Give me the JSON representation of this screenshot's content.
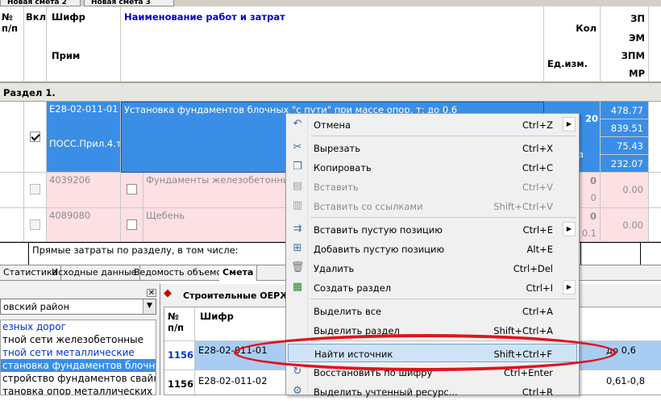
{
  "top_tabs": [
    "Новая смета 2",
    "Новая смета 3"
  ],
  "grid": {
    "headers": {
      "num": "№\nп/п",
      "vkl": "Вкл",
      "shifr": "Шифр",
      "prim": "Прим",
      "name": "Наименование работ и затрат",
      "kol": "Кол",
      "ed": "Ед.изм.",
      "zp": "ЗП",
      "em": "ЭМ",
      "zpm": "ЗПМ",
      "mr": "МР"
    },
    "section_label": "Раздел 1.",
    "main_row": {
      "code": "Е28-02-011-01",
      "name": "Установка фундаментов блочных \"с пути\" при массе опор, т: до 0,6",
      "prim": "ПОСС.Прил.4.т",
      "qty": "20",
      "unit_fragment": "а",
      "zp": "478.77",
      "em": "839.51",
      "zpm": "75.43",
      "mr": "232.07",
      "checked": true
    },
    "sub_rows": [
      {
        "code": "4039206",
        "name": "Фундаменты железобетонные",
        "qty": "0",
        "qty2": "0",
        "val": "0.00"
      },
      {
        "code": "4089080",
        "name": "Щебень",
        "qty": "0",
        "qty2": "0.1",
        "val": "0.00"
      }
    ],
    "footer_text": "Прямые затраты по разделу, в том числе:"
  },
  "bottom_tabs": [
    "Статистика",
    "Исходные данные",
    "Ведомость объемов",
    "Смета"
  ],
  "left_panel": {
    "combo_value": "овский район",
    "tree_items": [
      "езных дорог",
      "тной сети железобетонные",
      "тной сети металлические",
      "становка фундаментов блочнь",
      "стройство фундаментов свайн",
      "тановка опор металлических"
    ],
    "selected_index": 3
  },
  "right_panel": {
    "title": "Строительные ОЕРЖ (",
    "col_num": "№\nп/п",
    "col_shifr": "Шифр",
    "rows": [
      {
        "num": "1156",
        "code": "Е28-02-011-01",
        "desc": "до 0,6"
      },
      {
        "num": "1156",
        "code": "Е28-02-011-02",
        "desc": "0,61-0,8"
      }
    ]
  },
  "context_menu": {
    "items": [
      {
        "label": "Отмена",
        "shortcut": "Ctrl+Z",
        "icon": "undo-icon",
        "submenu": true,
        "disabled": false
      },
      {
        "label": "Вырезать",
        "shortcut": "Ctrl+X",
        "icon": "cut-icon",
        "disabled": false
      },
      {
        "label": "Копировать",
        "shortcut": "Ctrl+C",
        "icon": "copy-icon",
        "disabled": false
      },
      {
        "label": "Вставить",
        "shortcut": "Ctrl+V",
        "icon": "paste-icon",
        "disabled": true
      },
      {
        "label": "Вставить со ссылками",
        "shortcut": "Shift+Ctrl+V",
        "icon": "paste-link-icon",
        "disabled": true
      },
      {
        "label": "Вставить пустую позицию",
        "shortcut": "Ctrl+E",
        "icon": "insert-row-icon",
        "submenu": true,
        "disabled": false
      },
      {
        "label": "Добавить пустую позицию",
        "shortcut": "Alt+E",
        "icon": "add-row-icon",
        "disabled": false
      },
      {
        "label": "Удалить",
        "shortcut": "Ctrl+Del",
        "icon": "trash-icon",
        "disabled": false
      },
      {
        "label": "Создать раздел",
        "shortcut": "Ctrl+I",
        "icon": "create-section-icon",
        "submenu": true,
        "disabled": false
      },
      {
        "label": "Выделить все",
        "shortcut": "Ctrl+A",
        "icon": "",
        "disabled": false
      },
      {
        "label": "Выделить раздел",
        "shortcut": "Shift+Ctrl+A",
        "icon": "",
        "disabled": false
      },
      {
        "label": "Найти источник",
        "shortcut": "Shift+Ctrl+F",
        "icon": "",
        "disabled": false,
        "highlighted": true
      },
      {
        "label": "Восстановить по шифру",
        "shortcut": "Ctrl+Enter",
        "icon": "restore-icon",
        "disabled": false
      },
      {
        "label": "Выделить учтенный ресурс...",
        "shortcut": "Ctrl+R",
        "icon": "select-resource-icon",
        "disabled": false
      }
    ]
  },
  "colors": {
    "selection": "#3a8ee6",
    "pink_row": "#fde0e3",
    "annotation": "#e0141e"
  }
}
